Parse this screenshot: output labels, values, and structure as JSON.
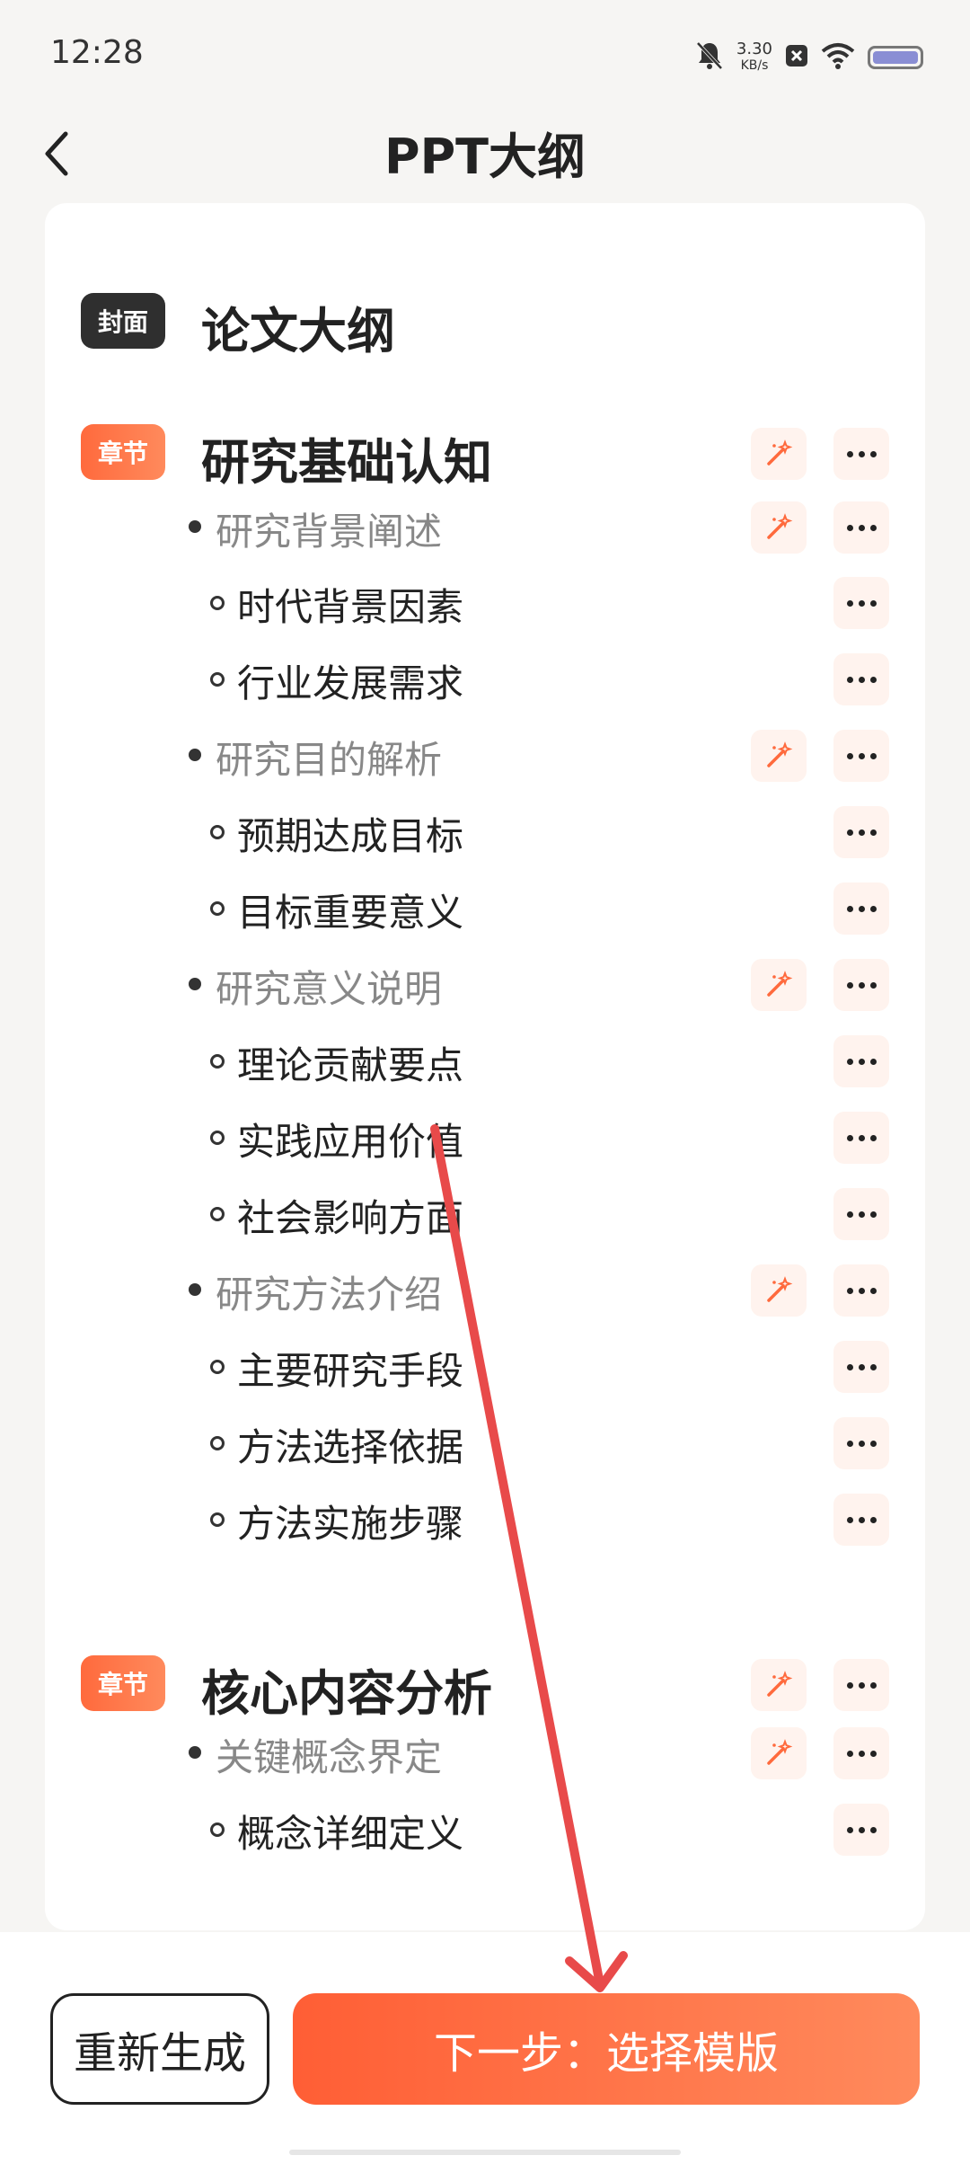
{
  "status_bar": {
    "time": "12:28",
    "net_speed_value": "3.30",
    "net_speed_unit": "KB/s",
    "icons": [
      "bell-muted-icon",
      "close-box-icon",
      "wifi-icon",
      "battery-icon"
    ]
  },
  "header": {
    "title": "PPT大纲",
    "back_icon": "back-chevron-icon"
  },
  "outline": {
    "cover": {
      "tag": "封面",
      "title": "论文大纲"
    },
    "chapters": [
      {
        "tag": "章节",
        "title": "研究基础认知",
        "sections": [
          {
            "title": "研究背景阐述",
            "items": [
              "时代背景因素",
              "行业发展需求"
            ]
          },
          {
            "title": "研究目的解析",
            "items": [
              "预期达成目标",
              "目标重要意义"
            ]
          },
          {
            "title": "研究意义说明",
            "items": [
              "理论贡献要点",
              "实践应用价值",
              "社会影响方面"
            ]
          },
          {
            "title": "研究方法介绍",
            "items": [
              "主要研究手段",
              "方法选择依据",
              "方法实施步骤"
            ]
          }
        ]
      },
      {
        "tag": "章节",
        "title": "核心内容分析",
        "sections": [
          {
            "title": "关键概念界定",
            "items": [
              "概念详细定义"
            ]
          }
        ]
      }
    ]
  },
  "actions": {
    "regenerate_label": "重新生成",
    "next_label": "下一步：选择模版"
  },
  "colors": {
    "accent": "#ff6a3d",
    "action_bg": "#fff3ee",
    "annotation_arrow": "#e84a4a"
  }
}
